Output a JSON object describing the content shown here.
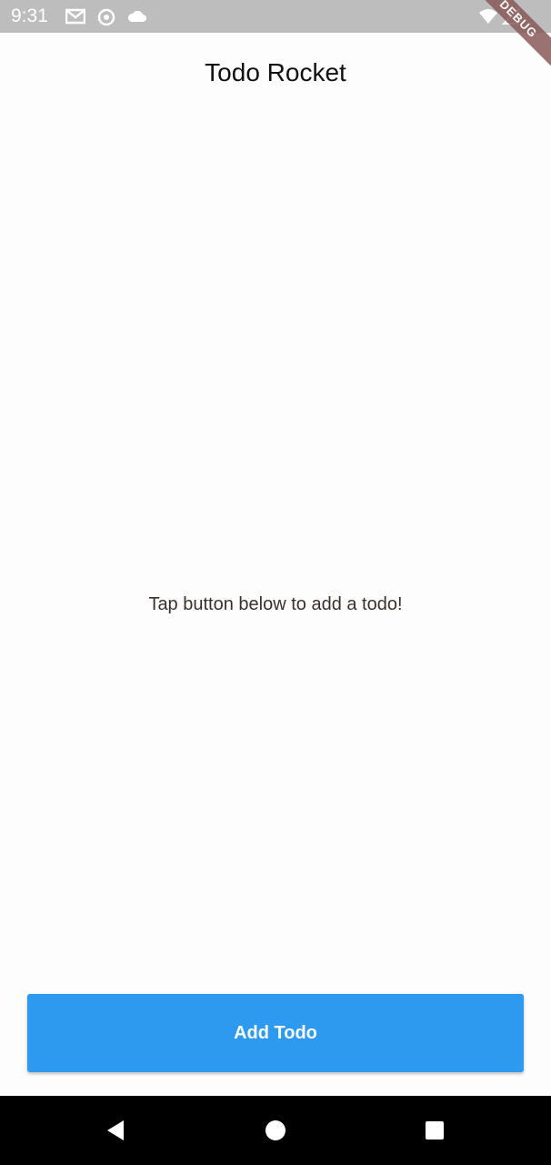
{
  "status_bar": {
    "time": "9:31",
    "icons": [
      "gmail-icon",
      "sync-icon",
      "cloud-icon",
      "wifi-icon",
      "signal-icon"
    ]
  },
  "debug_banner": "DEBUG",
  "app_bar": {
    "title": "Todo Rocket"
  },
  "empty_state": {
    "message": "Tap button below to add a todo!"
  },
  "add_button": {
    "label": "Add Todo",
    "color": "#2d9af0"
  },
  "nav_bar": {
    "buttons": [
      "back-icon",
      "home-icon",
      "recents-icon"
    ]
  }
}
